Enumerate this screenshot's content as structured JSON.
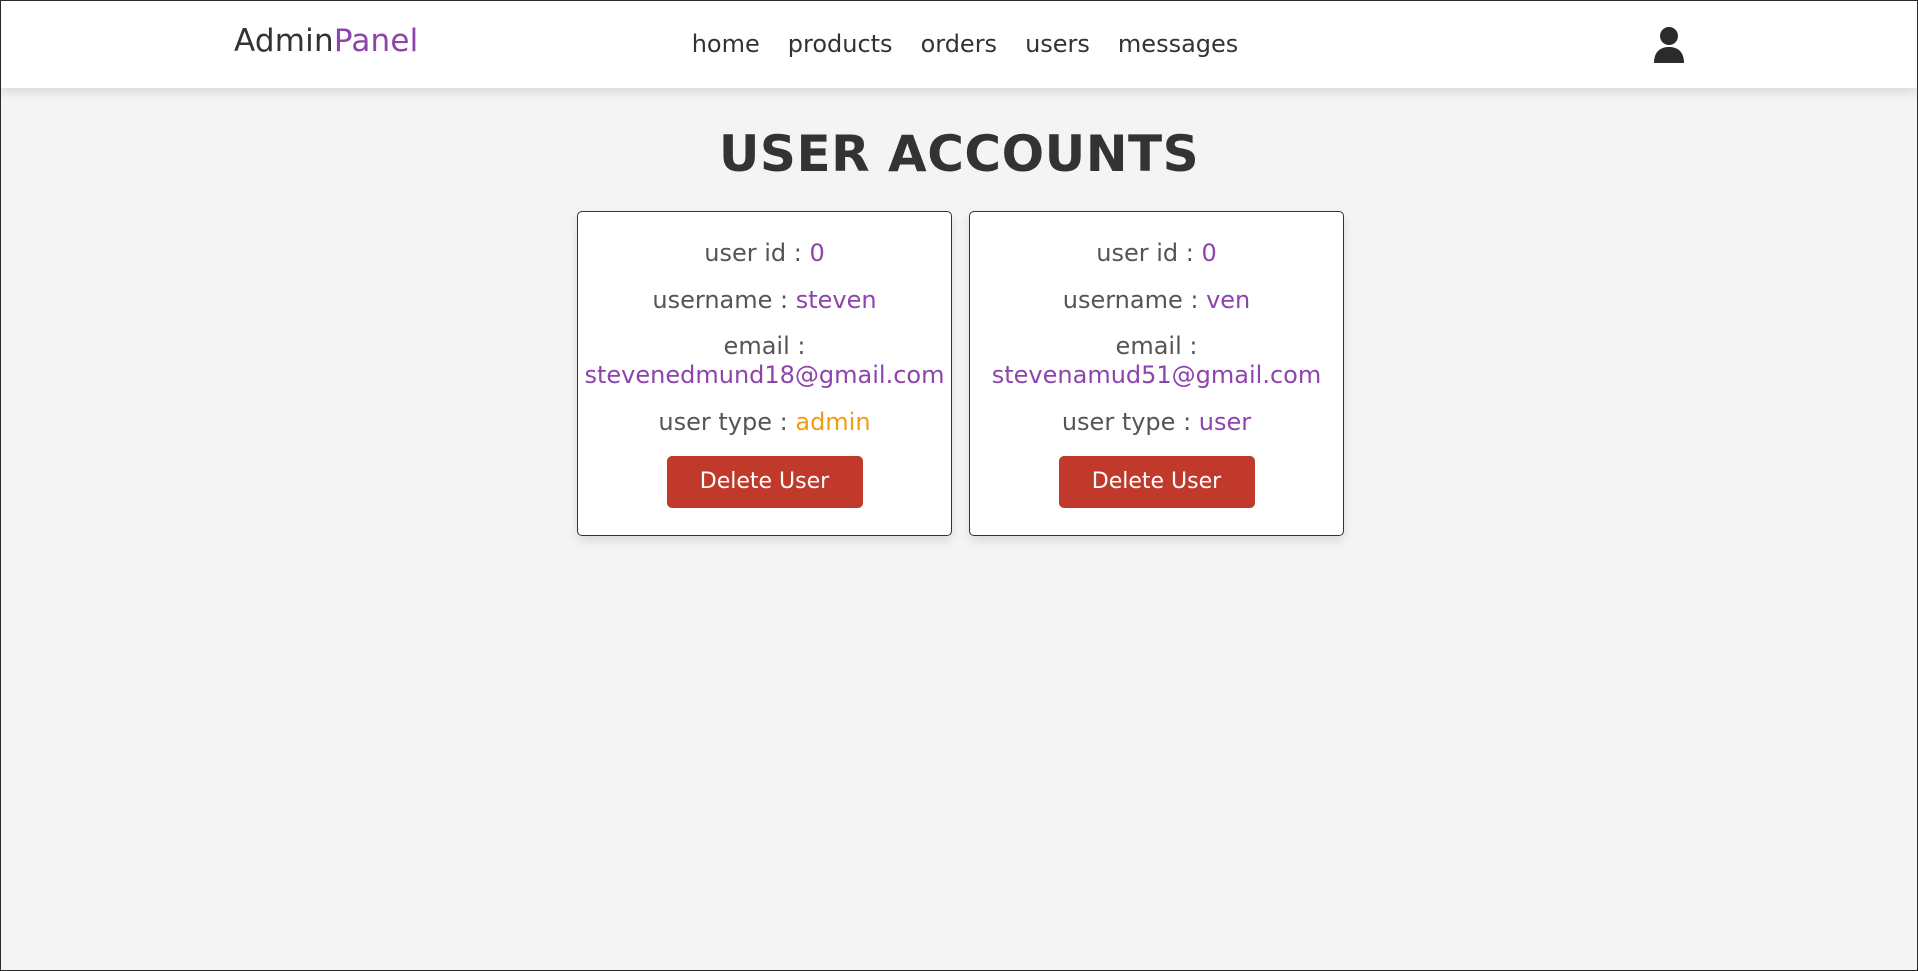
{
  "header": {
    "logo_main": "Admin",
    "logo_accent": "Panel",
    "nav": [
      "home",
      "products",
      "orders",
      "users",
      "messages"
    ],
    "user_icon": "user-icon"
  },
  "main": {
    "title": "USER ACCOUNTS",
    "labels": {
      "user_id": "user id : ",
      "username": "username : ",
      "email": "email : ",
      "user_type": "user type : "
    },
    "users": [
      {
        "user_id": "0",
        "username": "steven",
        "email": "stevenedmund18@gmail.com",
        "user_type": "admin",
        "delete_label": "Delete User"
      },
      {
        "user_id": "0",
        "username": "ven",
        "email": "stevenamud51@gmail.com",
        "user_type": "user",
        "delete_label": "Delete User"
      }
    ]
  },
  "colors": {
    "accent": "#8e44ad",
    "admin_type": "#f39c12",
    "delete_button": "#c0392b",
    "background": "#f4f4f4",
    "text": "#333333"
  }
}
